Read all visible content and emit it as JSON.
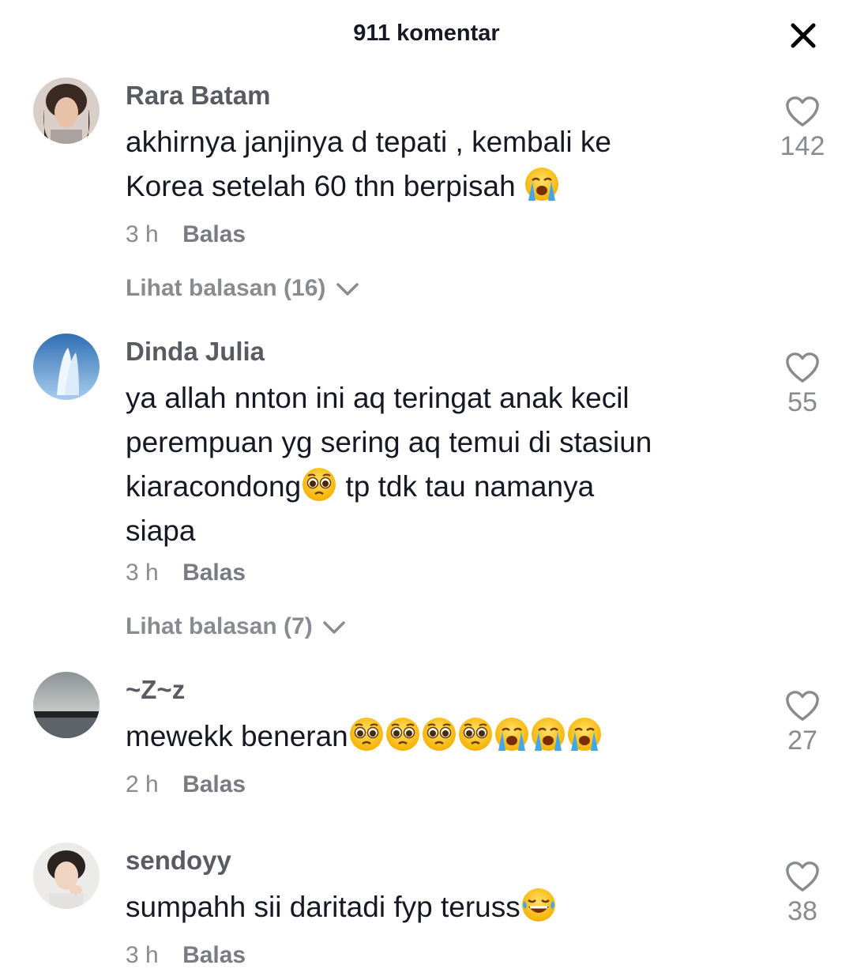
{
  "header": {
    "title": "911 komentar",
    "close_icon": "close-icon"
  },
  "comments": [
    {
      "username": "Rara Batam",
      "text_parts": [
        "akhirnya janjinya d tepati , kembali ke\nKorea setelah 60 thn berpisah "
      ],
      "emojis": [
        "loudly-crying-face"
      ],
      "time": "3 h",
      "reply_label": "Balas",
      "view_replies": "Lihat balasan (16)",
      "likes": "142"
    },
    {
      "username": "Dinda Julia",
      "text_parts": [
        "ya allah nnton ini aq teringat anak kecil\nperempuan yg sering aq temui di stasiun\nkiaracondong",
        " tp tdk tau namanya\nsiapa"
      ],
      "emojis": [
        "pleading-face"
      ],
      "time": "3 h",
      "reply_label": "Balas",
      "view_replies": "Lihat balasan (7)",
      "likes": "55"
    },
    {
      "username": "~Z~z",
      "text_parts": [
        "mewekk beneran"
      ],
      "emojis": [
        "pleading-face",
        "pleading-face",
        "pleading-face",
        "pleading-face",
        "loudly-crying-face",
        "loudly-crying-face",
        "loudly-crying-face"
      ],
      "time": "2 h",
      "reply_label": "Balas",
      "likes": "27"
    },
    {
      "username": "sendoyy",
      "text_parts": [
        "sumpahh sii daritadi fyp teruss"
      ],
      "emojis": [
        "tears-of-joy-face"
      ],
      "time": "3 h",
      "reply_label": "Balas",
      "likes": "38"
    }
  ],
  "colors": {
    "text": "#161823",
    "muted": "#8a8b91",
    "username": "#5a5b62"
  }
}
